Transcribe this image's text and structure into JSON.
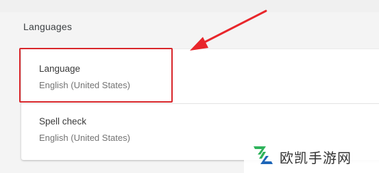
{
  "section": {
    "title": "Languages"
  },
  "rows": [
    {
      "label": "Language",
      "value": "English (United States)"
    },
    {
      "label": "Spell check",
      "value": "English (United States)"
    }
  ],
  "annotation": {
    "highlight_color": "#d8252a",
    "arrow_color": "#e8262b"
  },
  "watermark": {
    "text": "欧凯手游网",
    "logo_icon": "okay-logo-icon",
    "logo_color_green": "#2fb35b",
    "logo_color_blue": "#1e66b8"
  }
}
